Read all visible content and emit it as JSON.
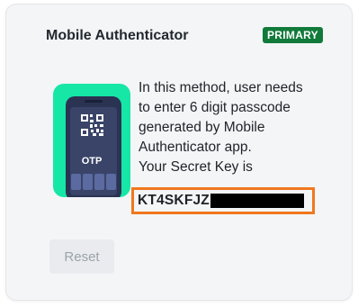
{
  "card": {
    "title": "Mobile Authenticator",
    "badge": "PRIMARY",
    "description_lines": [
      "In this method, user needs",
      "to enter 6 digit passcode",
      "generated by Mobile",
      "Authenticator app.",
      "Your Secret Key is"
    ],
    "secret_key_visible": "KT4SKFJZ",
    "reset_label": "Reset",
    "icon": {
      "name": "mobile-otp-phone-icon",
      "label": "OTP"
    }
  },
  "colors": {
    "icon_background": "#16e7a6",
    "badge_background": "#117a3b",
    "highlight_border": "#f0781e",
    "phone_body": "#2b3353",
    "card_background": "#f4f5f7"
  }
}
